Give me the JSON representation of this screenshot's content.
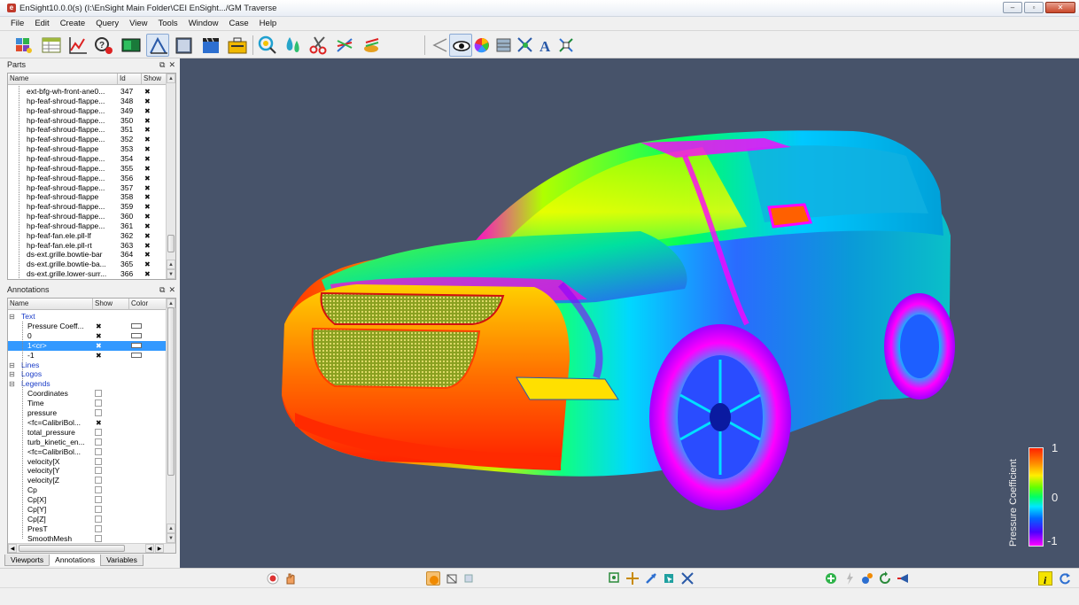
{
  "window": {
    "title": "EnSight10.0.0(s) (I:\\EnSight Main Folder\\CEI EnSight.../GM Traverse",
    "controls": [
      "–",
      "▫",
      "✕"
    ]
  },
  "menu": [
    "File",
    "Edit",
    "Create",
    "Query",
    "View",
    "Tools",
    "Window",
    "Case",
    "Help"
  ],
  "parts_panel": {
    "title": "Parts",
    "columns": [
      "Name",
      "Id",
      "Show"
    ],
    "rows": [
      {
        "name": "ext-bfg-wh-front-ane0...",
        "id": "347"
      },
      {
        "name": "hp-feaf-shroud-flappe...",
        "id": "348"
      },
      {
        "name": "hp-feaf-shroud-flappe...",
        "id": "349"
      },
      {
        "name": "hp-feaf-shroud-flappe...",
        "id": "350"
      },
      {
        "name": "hp-feaf-shroud-flappe...",
        "id": "351"
      },
      {
        "name": "hp-feaf-shroud-flappe...",
        "id": "352"
      },
      {
        "name": "hp-feaf-shroud-flappe",
        "id": "353"
      },
      {
        "name": "hp-feaf-shroud-flappe...",
        "id": "354"
      },
      {
        "name": "hp-feaf-shroud-flappe...",
        "id": "355"
      },
      {
        "name": "hp-feaf-shroud-flappe...",
        "id": "356"
      },
      {
        "name": "hp-feaf-shroud-flappe...",
        "id": "357"
      },
      {
        "name": "hp-feaf-shroud-flappe",
        "id": "358"
      },
      {
        "name": "hp-feaf-shroud-flappe...",
        "id": "359"
      },
      {
        "name": "hp-feaf-shroud-flappe...",
        "id": "360"
      },
      {
        "name": "hp-feaf-shroud-flappe...",
        "id": "361"
      },
      {
        "name": "hp-feaf-fan.ele.pll-lf",
        "id": "362"
      },
      {
        "name": "hp-feaf-fan.ele.pll-rt",
        "id": "363"
      },
      {
        "name": "ds-ext.grille.bowtie-bar",
        "id": "364"
      },
      {
        "name": "ds-ext.grille.bowtie-ba...",
        "id": "365"
      },
      {
        "name": "ds-ext.grille.lower-surr...",
        "id": "366"
      }
    ]
  },
  "annotations_panel": {
    "title": "Annotations",
    "columns": [
      "Name",
      "Show",
      "Color"
    ],
    "rows": [
      {
        "label": "Text",
        "level": 0,
        "kind": "group"
      },
      {
        "label": "Pressure Coeff...",
        "level": 1,
        "show": "x",
        "color": true
      },
      {
        "label": "0",
        "level": 1,
        "show": "x",
        "color": true
      },
      {
        "label": "1<cr>",
        "level": 1,
        "show": "x",
        "color": true,
        "selected": true
      },
      {
        "label": "-1",
        "level": 1,
        "show": "x",
        "color": true
      },
      {
        "label": "Lines",
        "level": 0,
        "kind": "group"
      },
      {
        "label": "Logos",
        "level": 0,
        "kind": "group"
      },
      {
        "label": "Legends",
        "level": 0,
        "kind": "group"
      },
      {
        "label": "Coordinates",
        "level": 1,
        "show": "box"
      },
      {
        "label": "Time",
        "level": 1,
        "show": "box"
      },
      {
        "label": "pressure",
        "level": 1,
        "show": "box"
      },
      {
        "label": "<fc=CalibriBol...",
        "level": 1,
        "show": "x"
      },
      {
        "label": "total_pressure",
        "level": 1,
        "show": "box"
      },
      {
        "label": "turb_kinetic_en...",
        "level": 1,
        "show": "box"
      },
      {
        "label": "<fc=CalibriBol...",
        "level": 1,
        "show": "box"
      },
      {
        "label": "velocity[X",
        "level": 1,
        "show": "box"
      },
      {
        "label": "velocity[Y",
        "level": 1,
        "show": "box"
      },
      {
        "label": "velocity[Z",
        "level": 1,
        "show": "box"
      },
      {
        "label": "Cp",
        "level": 1,
        "show": "box"
      },
      {
        "label": "Cp[X]",
        "level": 1,
        "show": "box"
      },
      {
        "label": "Cp[Y]",
        "level": 1,
        "show": "box"
      },
      {
        "label": "Cp[Z]",
        "level": 1,
        "show": "box"
      },
      {
        "label": "PresT",
        "level": 1,
        "show": "box"
      },
      {
        "label": "SmoothMesh",
        "level": 1,
        "show": "box"
      }
    ]
  },
  "tabs": [
    "Viewports",
    "Annotations",
    "Variables"
  ],
  "active_tab": "Annotations",
  "legend": {
    "title": "Pressure Coefficient",
    "max": "1",
    "mid": "0",
    "min": "-1",
    "colors": [
      "#ff2200",
      "#ff8800",
      "#ffee00",
      "#66ff00",
      "#00ff66",
      "#00e6ff",
      "#0066ff",
      "#4d00ff",
      "#ff00ff"
    ]
  },
  "colors": {
    "viewport_bg": "#47536a",
    "selection": "#3399ff"
  },
  "icons": {
    "toolbar_main": [
      "parts-icon",
      "table-icon",
      "plot-icon",
      "query-icon",
      "viewport-icon",
      "annotation-icon",
      "book-icon",
      "clapper-icon",
      "toolbox-icon",
      "isosurface-icon",
      "particle-icon",
      "clip-icon",
      "vector-arrows-icon",
      "elevated-surface-icon"
    ],
    "toolbar_right": [
      "line-icon",
      "eye-icon",
      "color-icon",
      "palette-icon",
      "node-icon",
      "text-icon",
      "transform-icon"
    ],
    "status_left": [
      "record-icon",
      "hand-icon"
    ],
    "status_mid": [
      "shaded-icon",
      "wireframe-icon",
      "hidden-line-icon"
    ],
    "status_tools": [
      "zoom-box-icon",
      "move-icon",
      "pointer-icon",
      "cursor-icon",
      "tools-icon"
    ],
    "status_right": [
      "zoom-in-icon",
      "light-icon",
      "rotate-icon",
      "reset-icon",
      "view-icon"
    ],
    "status_far": [
      "info-icon",
      "refresh-icon"
    ]
  }
}
